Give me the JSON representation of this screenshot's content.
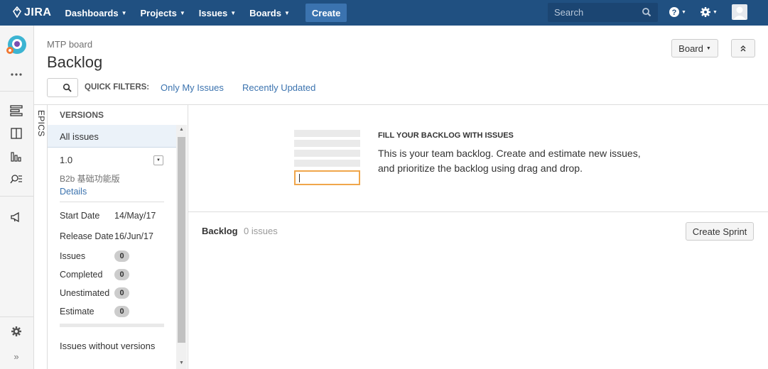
{
  "nav": {
    "logo": "JIRA",
    "items": [
      {
        "label": "Dashboards"
      },
      {
        "label": "Projects"
      },
      {
        "label": "Issues"
      },
      {
        "label": "Boards"
      }
    ],
    "create_label": "Create",
    "search_placeholder": "Search"
  },
  "sidebar": {
    "icons": [
      "project-avatar",
      "more-icon",
      "backlog-icon",
      "board-icon",
      "reports-icon",
      "issues-search-icon",
      "releases-icon",
      "settings-icon",
      "collapse-icon"
    ]
  },
  "header": {
    "breadcrumb": "MTP board",
    "title": "Backlog",
    "board_button": "Board"
  },
  "quick_filters": {
    "label": "QUICK FILTERS:",
    "filters": [
      "Only My Issues",
      "Recently Updated"
    ]
  },
  "epics_tab": "EPICS",
  "versions": {
    "title": "VERSIONS",
    "all_issues": "All issues",
    "version": {
      "name": "1.0",
      "description": "B2b 基础功能版",
      "details_link": "Details",
      "start_date_label": "Start Date",
      "start_date": "14/May/17",
      "release_date_label": "Release Date",
      "release_date": "16/Jun/17",
      "stats": [
        {
          "label": "Issues",
          "count": "0"
        },
        {
          "label": "Completed",
          "count": "0"
        },
        {
          "label": "Unestimated",
          "count": "0"
        },
        {
          "label": "Estimate",
          "count": "0"
        }
      ]
    },
    "without_versions": "Issues without versions"
  },
  "empty_state": {
    "title": "FILL YOUR BACKLOG WITH ISSUES",
    "text": "This is your team backlog. Create and estimate new issues, and prioritize the backlog using drag and drop."
  },
  "backlog": {
    "label": "Backlog",
    "count": "0 issues",
    "create_sprint": "Create Sprint"
  }
}
